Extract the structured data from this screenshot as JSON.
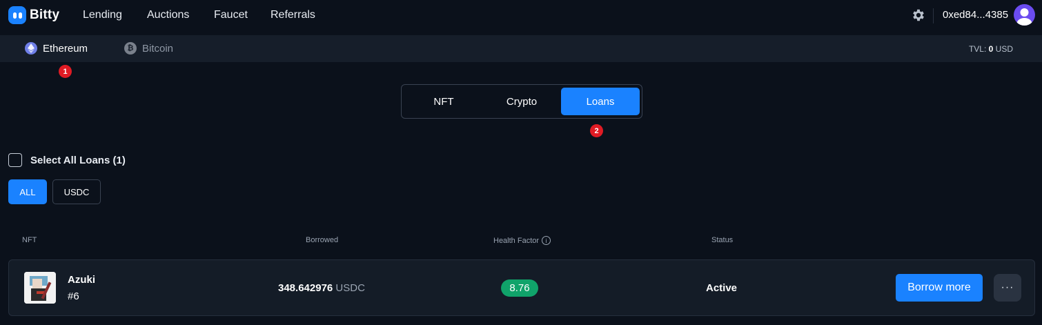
{
  "brand": {
    "name": "Bitty",
    "accent": "#1a82ff"
  },
  "nav": {
    "items": [
      {
        "label": "Lending"
      },
      {
        "label": "Auctions"
      },
      {
        "label": "Faucet"
      },
      {
        "label": "Referrals"
      }
    ],
    "settings_icon": "gear-icon",
    "wallet_address": "0xed84...4385"
  },
  "chains": {
    "items": [
      {
        "label": "Ethereum",
        "icon": "ethereum-icon",
        "selected": true
      },
      {
        "label": "Bitcoin",
        "icon": "bitcoin-icon",
        "selected": false
      }
    ],
    "tvl_label": "TVL:",
    "tvl_value": "0",
    "tvl_unit": "USD"
  },
  "badges": [
    "1",
    "2"
  ],
  "tabs": [
    {
      "label": "NFT",
      "active": false
    },
    {
      "label": "Crypto",
      "active": false
    },
    {
      "label": "Loans",
      "active": true
    }
  ],
  "select_all_label": "Select All Loans (1)",
  "filters": [
    {
      "label": "ALL",
      "active": true
    },
    {
      "label": "USDC",
      "active": false
    }
  ],
  "table": {
    "headers": {
      "nft": "NFT",
      "borrowed": "Borrowed",
      "health": "Health Factor",
      "status": "Status"
    },
    "rows": [
      {
        "name": "Azuki",
        "id": "#6",
        "borrowed_amount": "348.642976",
        "borrowed_currency": "USDC",
        "health_factor": "8.76",
        "status": "Active",
        "action_label": "Borrow more",
        "more_label": "···"
      }
    ]
  }
}
